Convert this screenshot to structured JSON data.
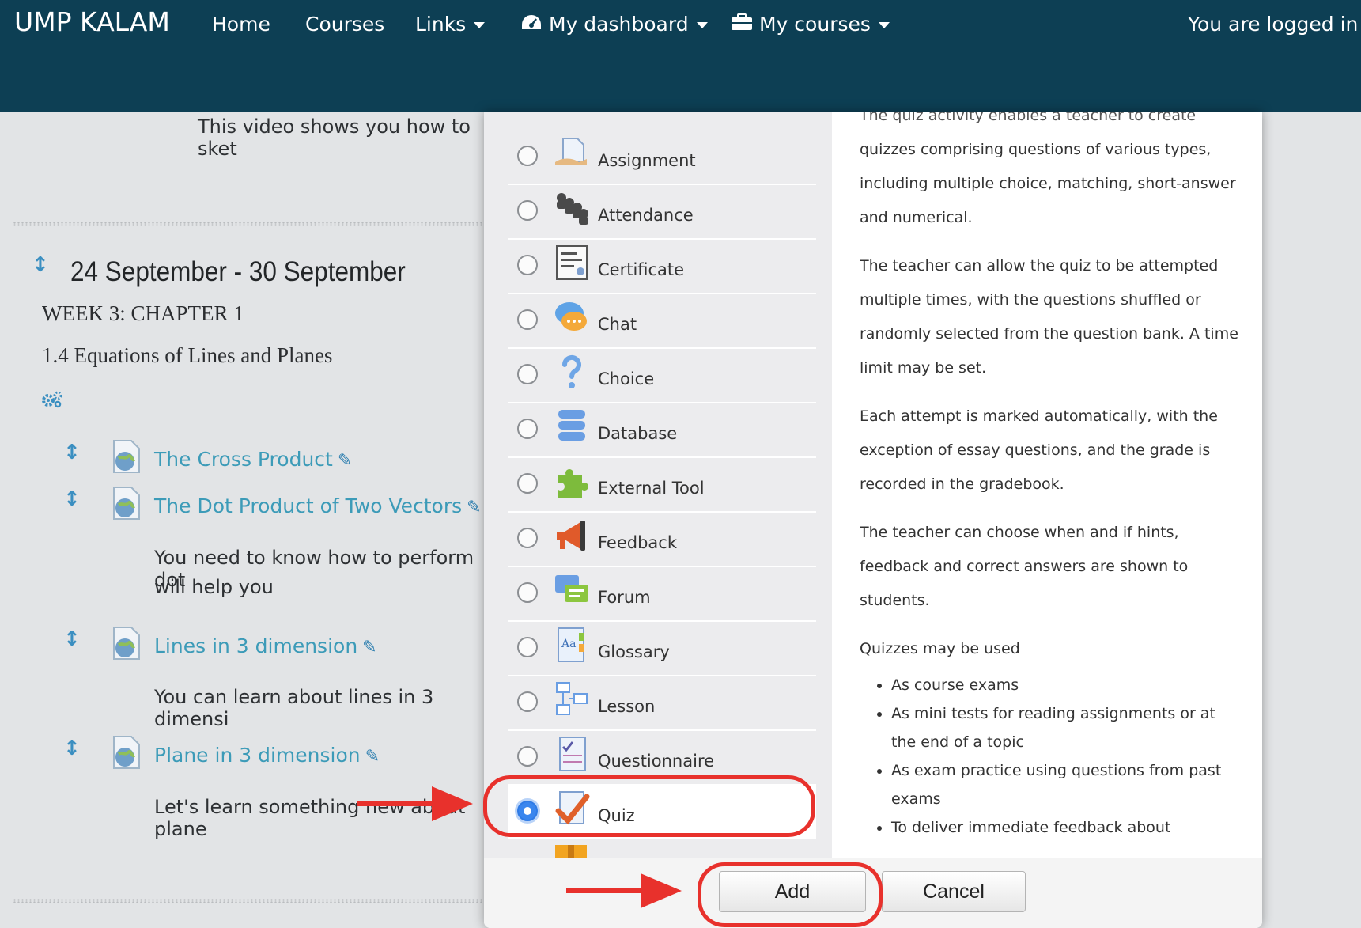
{
  "navbar": {
    "brand": "UMP KALAM",
    "home": "Home",
    "courses": "Courses",
    "links": "Links",
    "my_dashboard": "My dashboard",
    "my_courses": "My courses",
    "logged_in": "You are logged in as"
  },
  "course": {
    "video_note": "This video shows you how to sket",
    "section_title": "24 September - 30 September",
    "week": "WEEK 3: CHAPTER 1",
    "subtopic": "1.4 Equations of Lines and Planes",
    "activities": [
      {
        "title": "The Cross Product"
      },
      {
        "title": "The Dot Product of Two Vectors",
        "desc_line1": "You need to know how to perform dot",
        "desc_line2": "will help you"
      },
      {
        "title": "Lines in 3 dimension",
        "desc_line1": "You can learn about lines in 3 dimensi"
      },
      {
        "title": "Plane in 3 dimension",
        "desc_line1": "Let's learn something new about plane"
      }
    ]
  },
  "chooser": {
    "options": [
      "Assignment",
      "Attendance",
      "Certificate",
      "Chat",
      "Choice",
      "Database",
      "External Tool",
      "Feedback",
      "Forum",
      "Glossary",
      "Lesson",
      "Questionnaire",
      "Quiz"
    ],
    "selected": "Quiz",
    "help_top": "The quiz activity enables a teacher to create",
    "help_p1": "quizzes comprising questions of various types, including multiple choice, matching, short-answer and numerical.",
    "help_p2": "The teacher can allow the quiz to be attempted multiple times, with the questions shuffled or randomly selected from the question bank. A time limit may be set.",
    "help_p3": "Each attempt is marked automatically, with the exception of essay questions, and the grade is recorded in the gradebook.",
    "help_p4": "The teacher can choose when and if hints, feedback and correct answers are shown to students.",
    "help_p5": "Quizzes may be used",
    "help_list": [
      "As course exams",
      "As mini tests for reading assignments or at the end of a topic",
      "As exam practice using questions from past exams",
      "To deliver immediate feedback about"
    ],
    "add_label": "Add",
    "cancel_label": "Cancel"
  },
  "colors": {
    "navbar": "#0d3f54",
    "link": "#3c9bb8",
    "annotation": "#e8312c",
    "radio_selected": "#3a86ee"
  }
}
